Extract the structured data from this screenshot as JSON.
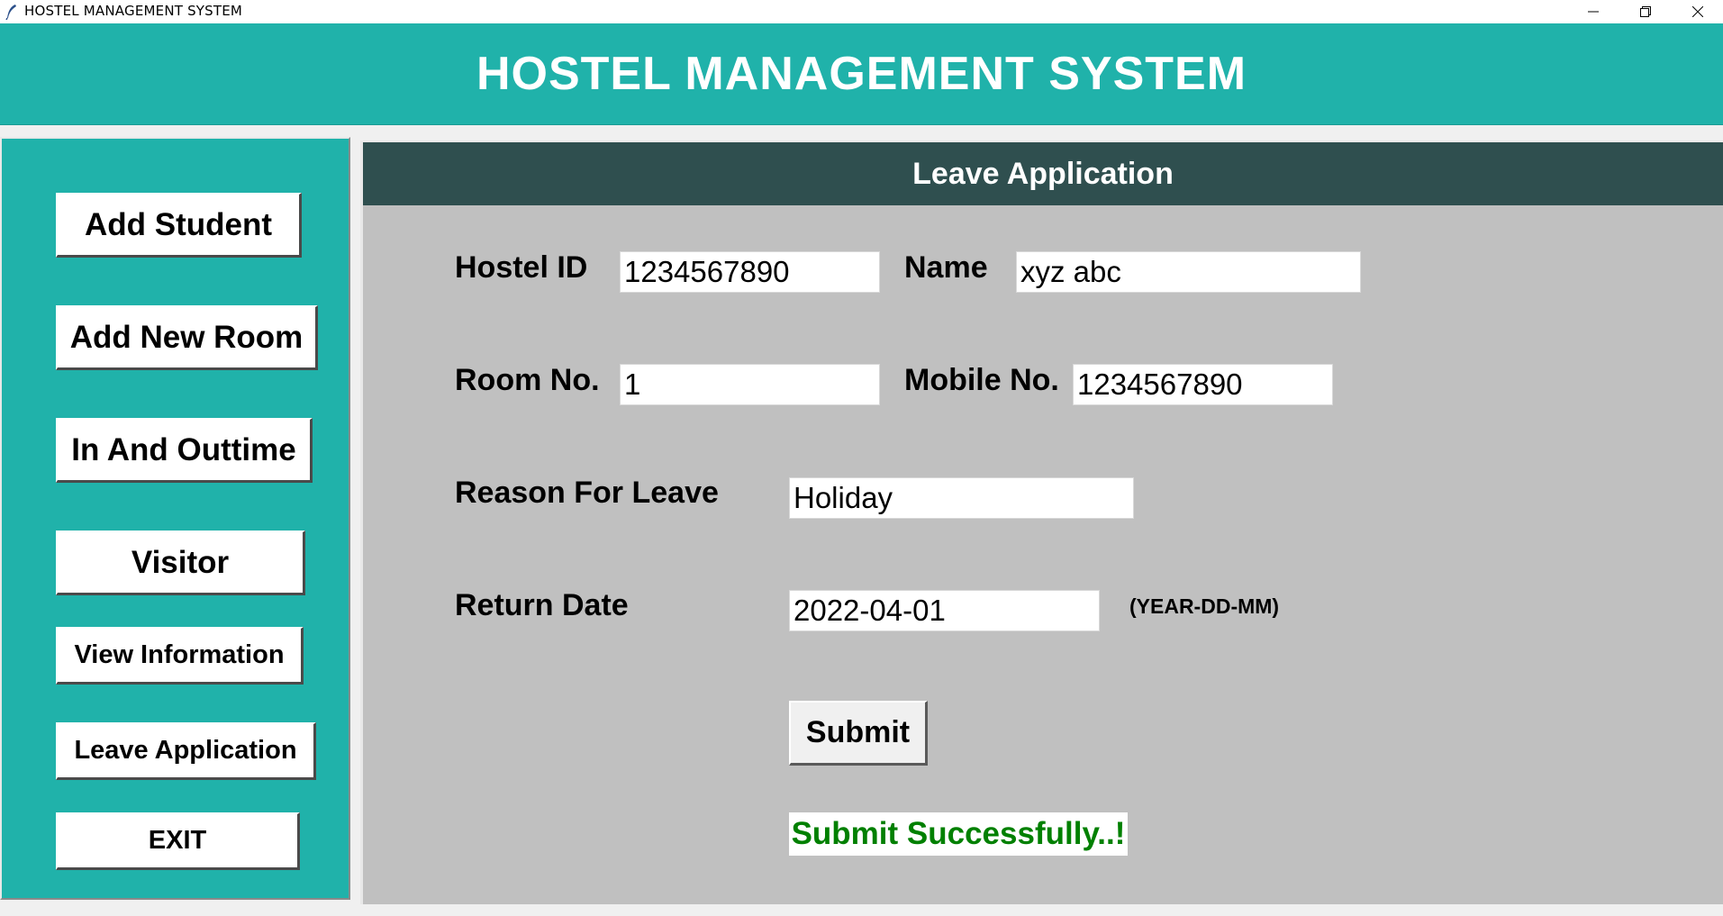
{
  "window": {
    "title": "HOSTEL MANAGEMENT SYSTEM",
    "icon": "feather-icon",
    "controls": [
      "minimize-icon",
      "restore-icon",
      "close-icon"
    ]
  },
  "header": {
    "title": "HOSTEL MANAGEMENT SYSTEM"
  },
  "sidebar": {
    "items": [
      {
        "label": "Add Student"
      },
      {
        "label": "Add New Room"
      },
      {
        "label": "In And Outtime"
      },
      {
        "label": "Visitor"
      },
      {
        "label": "View Information"
      },
      {
        "label": "Leave Application"
      },
      {
        "label": "EXIT"
      }
    ]
  },
  "form": {
    "title": "Leave Application",
    "hostel_id": {
      "label": "Hostel ID",
      "value": "1234567890"
    },
    "name": {
      "label": "Name",
      "value": "xyz abc"
    },
    "room_no": {
      "label": "Room No.",
      "value": "1"
    },
    "mobile_no": {
      "label": "Mobile No.",
      "value": "1234567890"
    },
    "reason": {
      "label": "Reason For Leave",
      "value": "Holiday"
    },
    "return_date": {
      "label": "Return Date",
      "value": "2022-04-01",
      "hint": "(YEAR-DD-MM)"
    },
    "submit_label": "Submit",
    "status_message": "Submit Successfully..!"
  },
  "colors": {
    "teal": "#20b2aa",
    "dark_slate": "#2f4f4f",
    "panel_gray": "#c0c0c0",
    "success_green": "#008000"
  }
}
